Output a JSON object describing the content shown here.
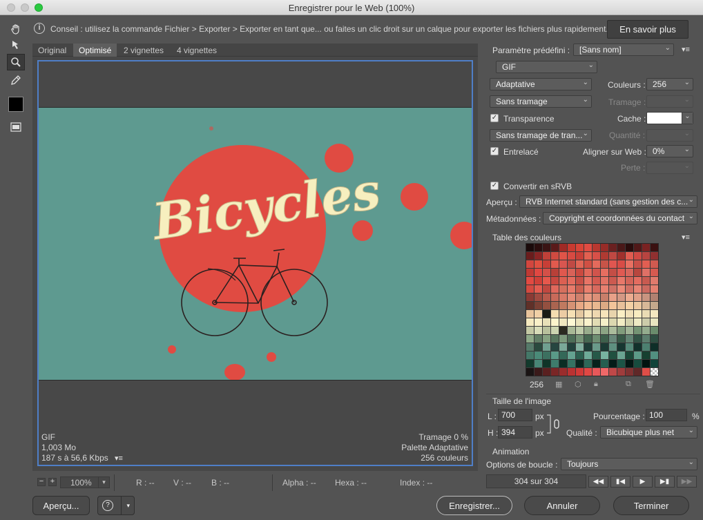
{
  "window": {
    "title": "Enregistrer pour le Web (100%)"
  },
  "tip": {
    "text": "Conseil : utilisez la commande Fichier > Exporter > Exporter en tant que... ou faites un clic droit sur un calque pour exporter les fichiers plus rapidement.",
    "learn_more": "En savoir plus"
  },
  "tabs": [
    "Original",
    "Optimisé",
    "2 vignettes",
    "4 vignettes"
  ],
  "artwork": {
    "title": "Bicycles"
  },
  "preview_info": {
    "format": "GIF",
    "size": "1,003 Mo",
    "time": "187 s à 56,6 Kbps",
    "dither": "Tramage 0 %",
    "palette": "Palette Adaptative",
    "colors": "256 couleurs"
  },
  "status": {
    "zoom": "100%",
    "r": "R : --",
    "v": "V : --",
    "b": "B : --",
    "alpha": "Alpha : --",
    "hexa": "Hexa : --",
    "index": "Index : --"
  },
  "bottom": {
    "preview": "Aperçu...",
    "save": "Enregistrer...",
    "cancel": "Annuler",
    "done": "Terminer"
  },
  "settings": {
    "preset_label": "Paramètre prédéfini :",
    "preset_value": "[Sans nom]",
    "format": "GIF",
    "reduction": "Adaptative",
    "colors_label": "Couleurs :",
    "colors_value": "256",
    "dither_algo": "Sans tramage",
    "dither_label": "Tramage :",
    "transparency_label": "Transparence",
    "matte_label": "Cache :",
    "trans_dither": "Sans tramage de tran...",
    "amount_label": "Quantité :",
    "interlaced_label": "Entrelacé",
    "web_snap_label": "Aligner sur Web :",
    "web_snap_value": "0%",
    "lossy_label": "Perte :",
    "convert_srgb_label": "Convertir en sRVB",
    "preview_label": "Aperçu :",
    "preview_value": "RVB Internet standard (sans gestion des c...",
    "metadata_label": "Métadonnées :",
    "metadata_value": "Copyright et coordonnées du contact",
    "color_table_label": "Table des couleurs",
    "color_count": "256"
  },
  "image_size": {
    "section_label": "Taille de l'image",
    "w_label": "L :",
    "w_value": "700",
    "h_label": "H :",
    "h_value": "394",
    "unit": "px",
    "percent_label": "Pourcentage :",
    "percent_value": "100",
    "percent_unit": "%",
    "quality_label": "Qualité :",
    "quality_value": "Bicubique plus net"
  },
  "animation": {
    "section_label": "Animation",
    "loop_label": "Options de boucle :",
    "loop_value": "Toujours",
    "frame_counter": "304 sur 304"
  },
  "colors": {
    "panel_bg": "#535353",
    "artwork_bg": "#5e9a90",
    "circle_red": "#e04b42",
    "text_cream": "#f7efbf",
    "frame_blue": "#4f7fc8"
  }
}
